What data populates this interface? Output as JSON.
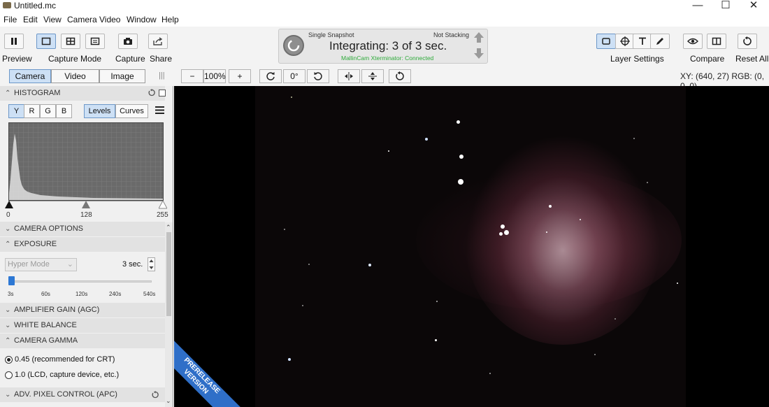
{
  "window": {
    "title": "Untitled.mc",
    "min": "—",
    "max": "☐",
    "close": "✕"
  },
  "menu": [
    "File",
    "Edit",
    "View",
    "Camera",
    "Video",
    "Window",
    "Help"
  ],
  "toolbar": {
    "preview": "Preview",
    "capture_mode": "Capture Mode",
    "capture": "Capture",
    "share": "Share",
    "layer_settings": "Layer Settings",
    "compare": "Compare",
    "reset_all": "Reset All"
  },
  "status": {
    "mode": "Single Snapshot",
    "stacking": "Not Stacking",
    "main": "Integrating: 3 of 3 sec.",
    "device": "MallinCam Xterminator: Connected",
    "device_color": "#2eaa3a"
  },
  "tabs": {
    "camera": "Camera",
    "video": "Video",
    "image": "Image"
  },
  "view": {
    "zoom_out": "−",
    "zoom": "100%",
    "zoom_in": "+",
    "rotation": "0°",
    "readout": "XY: (640, 27)  RGB: (0, 0, 0)"
  },
  "histogram": {
    "title": "HISTOGRAM",
    "channels": [
      "Y",
      "R",
      "G",
      "B"
    ],
    "levels": "Levels",
    "curves": "Curves",
    "ticks": [
      "0",
      "128",
      "255"
    ]
  },
  "sections": {
    "camera_options": "CAMERA OPTIONS",
    "exposure": "EXPOSURE",
    "amplifier_gain": "AMPLIFIER GAIN (AGC)",
    "white_balance": "WHITE BALANCE",
    "camera_gamma": "CAMERA GAMMA",
    "adv_pixel": "ADV. PIXEL CONTROL (APC)"
  },
  "exposure": {
    "mode": "Hyper Mode",
    "value": "3 sec.",
    "slider_ticks": [
      "3s",
      "60s",
      "120s",
      "240s",
      "540s"
    ],
    "slider_level": 0.0
  },
  "gamma": {
    "options": [
      "0.45 (recommended for CRT)",
      "1.0 (LCD, capture device, etc.)"
    ],
    "selected": 0
  },
  "banner": {
    "line1": "PRERELEASE",
    "line2": "VERSION",
    "color": "#2f6fc8"
  },
  "colors": {
    "accent": "#cde0f5",
    "accent_border": "#6c97c8"
  }
}
